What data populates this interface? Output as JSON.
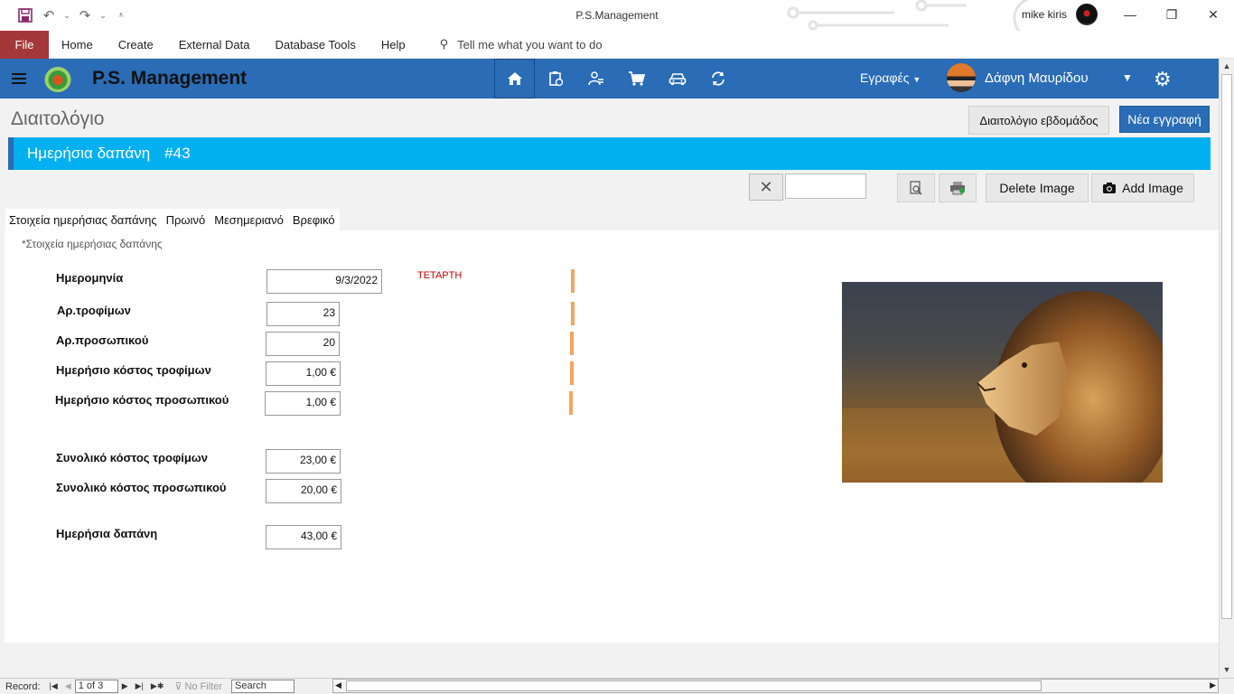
{
  "window": {
    "title": "P.S.Management",
    "user": "mike kiris"
  },
  "ribbon": {
    "file": "File",
    "tabs": [
      "Home",
      "Create",
      "External Data",
      "Database Tools",
      "Help"
    ],
    "tell_me": "Tell me what you want to do"
  },
  "app": {
    "name": "P.S. Management",
    "records_menu": "Εγραφές",
    "user_name": "Δάφνη Μαυρίδου",
    "accent": "#2a6cb5",
    "banner_color": "#00b0f0"
  },
  "page": {
    "title": "Διαιτολόγιο",
    "weekly_button": "Διαιτολόγιο εβδομάδος",
    "new_button": "Νέα εγγραφή",
    "banner_title": "Ημερήσια δαπάνη",
    "banner_id": "#43",
    "delete_image": "Delete Image",
    "add_image": "Add Image",
    "search_value": ""
  },
  "tabs": [
    "Στοιχεία ημερήσιας δαπάνης",
    "Πρωινό",
    "Μεσημεριανό",
    "Βρεφικό"
  ],
  "section": {
    "title": "*Στοιχεία ημερήσιας δαπάνης"
  },
  "fields": {
    "date_label": "Ημερομηνία",
    "date_value": "9/3/2022",
    "day_name": "ΤΕΤΑΡΤΗ",
    "children_label": "Αρ.τροφίμων",
    "children_value": "23",
    "staff_label": "Αρ.προσωπικού",
    "staff_value": "20",
    "daily_child_cost_label": "Ημερήσιο κόστος τροφίμων",
    "daily_child_cost_value": "1,00 €",
    "daily_staff_cost_label": "Ημερήσιο κόστος προσωπικού",
    "daily_staff_cost_value": "1,00 €",
    "total_child_cost_label": "Συνολικό κόστος τροφίμων",
    "total_child_cost_value": "23,00 €",
    "total_staff_cost_label": "Συνολικό κόστος προσωπικού",
    "total_staff_cost_value": "20,00 €",
    "daily_expense_label": "Ημερήσια δαπάνη",
    "daily_expense_value": "43,00 €"
  },
  "record_nav": {
    "label": "Record:",
    "position": "1 of 3",
    "filter": "No Filter",
    "search": "Search"
  }
}
